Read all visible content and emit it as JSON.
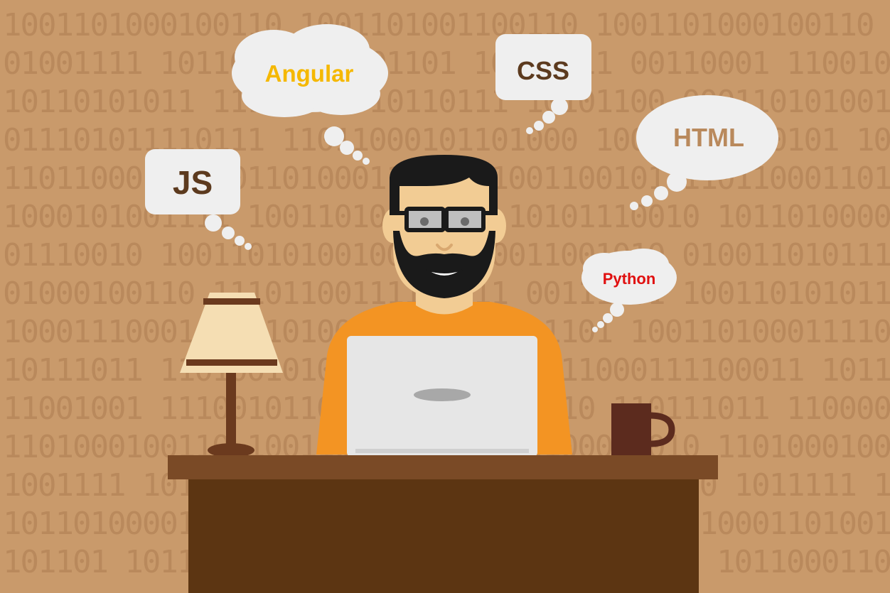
{
  "background": {
    "color": "#c99a6b",
    "digit_color": "#b9895c",
    "binary_rows": [
      "1001101000100110 1001101001100110 1001101000100110 10011010001001",
      "01001111 10110100 11001101 10100111 00110001 11001001",
      "10110101011 11110010 10110111 10101100 0001101010011011 010",
      "011101011110111 11011000101101000 10011010100101 10111110110001101",
      "11011000111 10110100011 10101001100101 11011000110101 01000111010",
      "1000101001111 10011010101010 10101110010 10110100000110111 0101",
      "01110010 10011010100100110 10011001010 0100110101111011 1001101",
      "01000100110 11101100111100111 00111101 1001101010111011 00011101011",
      "10001110001 10110100011 00110111101 100110100011110 100110100101",
      "10111011 11010010101 0110100 11011000111100011 10111010",
      "11001001 11100101101010 1010111010 110111011 11000001110111 001",
      "1101000100110 10011001010 10110100011010 1101000100110 11010000100",
      "1001111 1011010 10110100011 1010110110100 1011111 1011010",
      "1011010000110 10110101 1101000111010 1101000110100110 10100110",
      "101101 1011001 10110110 10011010 1011011 1011000110 101111"
    ]
  },
  "bubbles": {
    "js": {
      "text": "JS",
      "color": "#5c3a1e"
    },
    "angular": {
      "text": "Angular",
      "color": "#f5b800"
    },
    "css": {
      "text": "CSS",
      "color": "#5c3a1e"
    },
    "html": {
      "text": "HTML",
      "color": "#b9895c"
    },
    "python": {
      "text": "Python",
      "color": "#e01010"
    }
  }
}
